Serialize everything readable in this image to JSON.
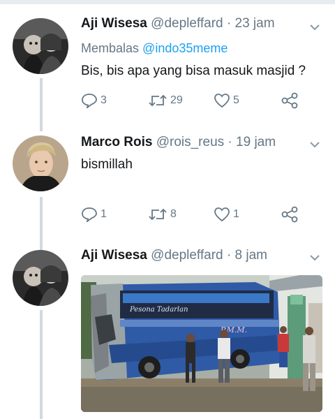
{
  "tweets": [
    {
      "name": "Aji Wisesa",
      "handle": "@depleffard",
      "time": "· 23 jam",
      "reply_prefix": "Membalas",
      "reply_mention": "@indo35meme",
      "text": "Bis, bis apa yang bisa masuk masjid ?",
      "replies": "3",
      "retweets": "29",
      "likes": "5"
    },
    {
      "name": "Marco Rois",
      "handle": "@rois_reus",
      "time": "· 19 jam",
      "text": "bismillah",
      "replies": "1",
      "retweets": "8",
      "likes": "1"
    },
    {
      "name": "Aji Wisesa",
      "handle": "@depleffard",
      "time": "· 8 jam",
      "image_text_1": "Pesona Tadarlan",
      "image_text_2": "P.M.M."
    }
  ],
  "icons": {
    "reply": "reply-icon",
    "retweet": "retweet-icon",
    "like": "heart-icon",
    "share": "share-icon",
    "menu": "chevron-down-icon"
  },
  "colors": {
    "text": "#14171a",
    "secondary": "#657786",
    "link": "#1da1f2",
    "thread_line": "#cfd9de"
  }
}
